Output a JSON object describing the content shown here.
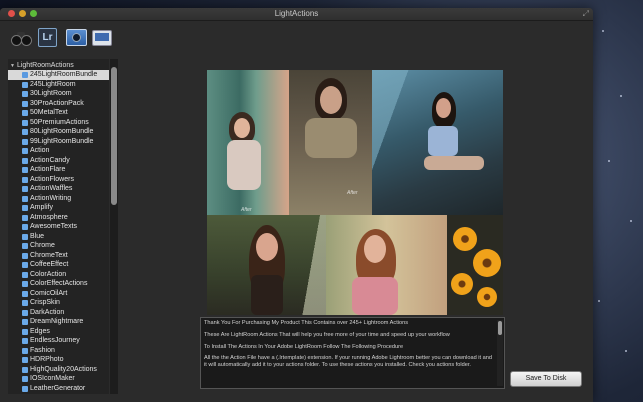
{
  "window": {
    "title": "LightActions"
  },
  "toolbar": {
    "icons": [
      "binoculars-icon",
      "lightroom-icon",
      "camera-icon",
      "screen-icon"
    ]
  },
  "sidebar": {
    "root_label": "LightRoomActions",
    "items": [
      "245LightRoomBundle",
      "245LightRoom",
      "30LightRoom",
      "30ProActionPack",
      "50MetalText",
      "50PremiumActions",
      "80LightRoomBundle",
      "99LightRoomBundle",
      "Action",
      "ActionCandy",
      "ActionFlare",
      "ActionFlowers",
      "ActionWaffles",
      "ActionWriting",
      "Amplify",
      "Atmosphere",
      "AwesomeTexts",
      "Blue",
      "Chrome",
      "ChromeText",
      "CoffeeEffect",
      "ColorAction",
      "ColorEffectActions",
      "ComicOilArt",
      "CrispSkin",
      "DarkAction",
      "DreamNightmare",
      "Edges",
      "EndlessJourney",
      "Fashion",
      "HDRPhoto",
      "HighQuality20Actions",
      "IOSIconMaker",
      "LeatherGenerator"
    ],
    "selected_index": 0
  },
  "preview": {
    "after_label": "After"
  },
  "description": {
    "paragraphs": [
      "Thank You For Purchasing My Product This Contains over 245+ Lightroom Actions",
      "These Are LightRoom Actions That will help you free more of your time and speed up your workflow",
      "To Install The Actions In Your Adobe LightRoom Follow The Following Procedure",
      "All the the Action File have a (.lrtemplate) extension. If your running Adobe Lightroom better you can download it and it will automatically add it to your actions folder. To use these actions you installed. Check you actions folder."
    ]
  },
  "buttons": {
    "save_label": "Save To Disk"
  },
  "colors": {
    "window_bg": "#2b2b2b",
    "selection": "#d9d9d9",
    "folder_icon": "#6aa9e8"
  }
}
